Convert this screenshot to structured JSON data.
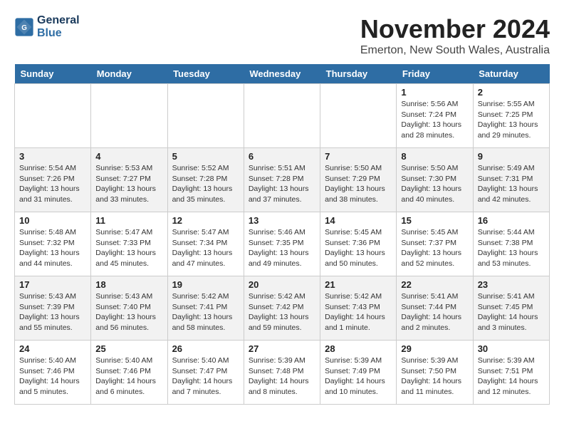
{
  "header": {
    "logo_line1": "General",
    "logo_line2": "Blue",
    "month": "November 2024",
    "location": "Emerton, New South Wales, Australia"
  },
  "weekdays": [
    "Sunday",
    "Monday",
    "Tuesday",
    "Wednesday",
    "Thursday",
    "Friday",
    "Saturday"
  ],
  "weeks": [
    [
      {
        "day": "",
        "info": ""
      },
      {
        "day": "",
        "info": ""
      },
      {
        "day": "",
        "info": ""
      },
      {
        "day": "",
        "info": ""
      },
      {
        "day": "",
        "info": ""
      },
      {
        "day": "1",
        "info": "Sunrise: 5:56 AM\nSunset: 7:24 PM\nDaylight: 13 hours\nand 28 minutes."
      },
      {
        "day": "2",
        "info": "Sunrise: 5:55 AM\nSunset: 7:25 PM\nDaylight: 13 hours\nand 29 minutes."
      }
    ],
    [
      {
        "day": "3",
        "info": "Sunrise: 5:54 AM\nSunset: 7:26 PM\nDaylight: 13 hours\nand 31 minutes."
      },
      {
        "day": "4",
        "info": "Sunrise: 5:53 AM\nSunset: 7:27 PM\nDaylight: 13 hours\nand 33 minutes."
      },
      {
        "day": "5",
        "info": "Sunrise: 5:52 AM\nSunset: 7:28 PM\nDaylight: 13 hours\nand 35 minutes."
      },
      {
        "day": "6",
        "info": "Sunrise: 5:51 AM\nSunset: 7:28 PM\nDaylight: 13 hours\nand 37 minutes."
      },
      {
        "day": "7",
        "info": "Sunrise: 5:50 AM\nSunset: 7:29 PM\nDaylight: 13 hours\nand 38 minutes."
      },
      {
        "day": "8",
        "info": "Sunrise: 5:50 AM\nSunset: 7:30 PM\nDaylight: 13 hours\nand 40 minutes."
      },
      {
        "day": "9",
        "info": "Sunrise: 5:49 AM\nSunset: 7:31 PM\nDaylight: 13 hours\nand 42 minutes."
      }
    ],
    [
      {
        "day": "10",
        "info": "Sunrise: 5:48 AM\nSunset: 7:32 PM\nDaylight: 13 hours\nand 44 minutes."
      },
      {
        "day": "11",
        "info": "Sunrise: 5:47 AM\nSunset: 7:33 PM\nDaylight: 13 hours\nand 45 minutes."
      },
      {
        "day": "12",
        "info": "Sunrise: 5:47 AM\nSunset: 7:34 PM\nDaylight: 13 hours\nand 47 minutes."
      },
      {
        "day": "13",
        "info": "Sunrise: 5:46 AM\nSunset: 7:35 PM\nDaylight: 13 hours\nand 49 minutes."
      },
      {
        "day": "14",
        "info": "Sunrise: 5:45 AM\nSunset: 7:36 PM\nDaylight: 13 hours\nand 50 minutes."
      },
      {
        "day": "15",
        "info": "Sunrise: 5:45 AM\nSunset: 7:37 PM\nDaylight: 13 hours\nand 52 minutes."
      },
      {
        "day": "16",
        "info": "Sunrise: 5:44 AM\nSunset: 7:38 PM\nDaylight: 13 hours\nand 53 minutes."
      }
    ],
    [
      {
        "day": "17",
        "info": "Sunrise: 5:43 AM\nSunset: 7:39 PM\nDaylight: 13 hours\nand 55 minutes."
      },
      {
        "day": "18",
        "info": "Sunrise: 5:43 AM\nSunset: 7:40 PM\nDaylight: 13 hours\nand 56 minutes."
      },
      {
        "day": "19",
        "info": "Sunrise: 5:42 AM\nSunset: 7:41 PM\nDaylight: 13 hours\nand 58 minutes."
      },
      {
        "day": "20",
        "info": "Sunrise: 5:42 AM\nSunset: 7:42 PM\nDaylight: 13 hours\nand 59 minutes."
      },
      {
        "day": "21",
        "info": "Sunrise: 5:42 AM\nSunset: 7:43 PM\nDaylight: 14 hours\nand 1 minute."
      },
      {
        "day": "22",
        "info": "Sunrise: 5:41 AM\nSunset: 7:44 PM\nDaylight: 14 hours\nand 2 minutes."
      },
      {
        "day": "23",
        "info": "Sunrise: 5:41 AM\nSunset: 7:45 PM\nDaylight: 14 hours\nand 3 minutes."
      }
    ],
    [
      {
        "day": "24",
        "info": "Sunrise: 5:40 AM\nSunset: 7:46 PM\nDaylight: 14 hours\nand 5 minutes."
      },
      {
        "day": "25",
        "info": "Sunrise: 5:40 AM\nSunset: 7:46 PM\nDaylight: 14 hours\nand 6 minutes."
      },
      {
        "day": "26",
        "info": "Sunrise: 5:40 AM\nSunset: 7:47 PM\nDaylight: 14 hours\nand 7 minutes."
      },
      {
        "day": "27",
        "info": "Sunrise: 5:39 AM\nSunset: 7:48 PM\nDaylight: 14 hours\nand 8 minutes."
      },
      {
        "day": "28",
        "info": "Sunrise: 5:39 AM\nSunset: 7:49 PM\nDaylight: 14 hours\nand 10 minutes."
      },
      {
        "day": "29",
        "info": "Sunrise: 5:39 AM\nSunset: 7:50 PM\nDaylight: 14 hours\nand 11 minutes."
      },
      {
        "day": "30",
        "info": "Sunrise: 5:39 AM\nSunset: 7:51 PM\nDaylight: 14 hours\nand 12 minutes."
      }
    ]
  ]
}
